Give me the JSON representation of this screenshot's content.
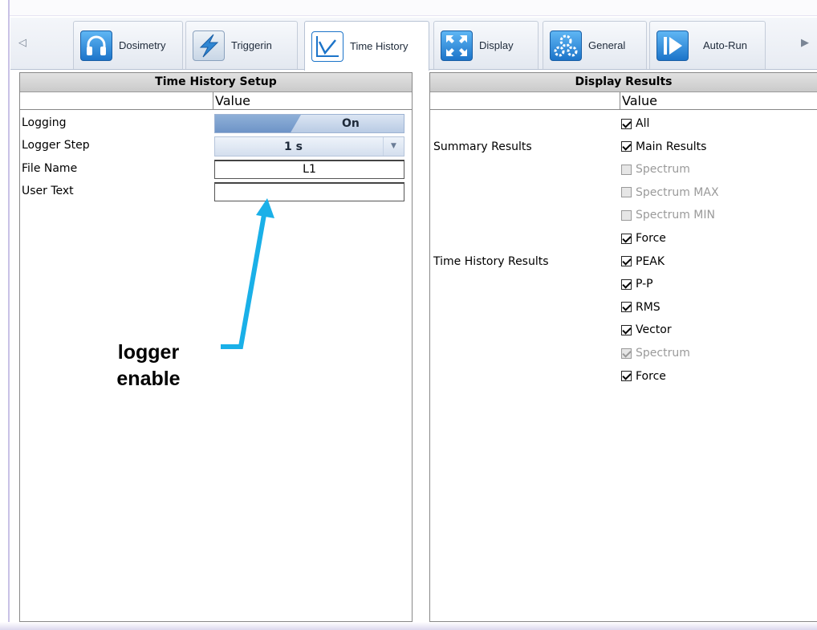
{
  "tabs": [
    {
      "label": "Dosimetry",
      "icon": "headphones-icon"
    },
    {
      "label": "Triggerin",
      "icon": "lightning-icon"
    },
    {
      "label": "Time History",
      "icon": "line-chart-icon",
      "active": true
    },
    {
      "label": "Display",
      "icon": "expand-arrows-icon"
    },
    {
      "label": "General",
      "icon": "gears-icon"
    },
    {
      "label": "Auto-Run",
      "icon": "play-icon"
    }
  ],
  "left_panel": {
    "title": "Time History Setup",
    "value_header": "Value",
    "rows": {
      "logging": {
        "label": "Logging",
        "value": "On",
        "level": 0.45
      },
      "logger_step": {
        "label": "Logger Step",
        "value": "1 s"
      },
      "file_name": {
        "label": "File Name",
        "value": "L1"
      },
      "user_text": {
        "label": "User Text",
        "value": ""
      }
    }
  },
  "right_panel": {
    "title": "Display Results",
    "value_header": "Value",
    "group_summary": "Summary Results",
    "group_time_history": "Time History Results",
    "items": [
      {
        "label": "All",
        "checked": true,
        "disabled": false
      },
      {
        "label": "Main Results",
        "checked": true,
        "disabled": false
      },
      {
        "label": "Spectrum",
        "checked": false,
        "disabled": true
      },
      {
        "label": "Spectrum MAX",
        "checked": false,
        "disabled": true
      },
      {
        "label": "Spectrum MIN",
        "checked": false,
        "disabled": true
      },
      {
        "label": "Force",
        "checked": true,
        "disabled": false
      },
      {
        "label": "PEAK",
        "checked": true,
        "disabled": false
      },
      {
        "label": "P-P",
        "checked": true,
        "disabled": false
      },
      {
        "label": "RMS",
        "checked": true,
        "disabled": false
      },
      {
        "label": "Vector",
        "checked": true,
        "disabled": false
      },
      {
        "label": "Spectrum",
        "checked": true,
        "disabled": true
      },
      {
        "label": "Force",
        "checked": true,
        "disabled": false
      }
    ]
  },
  "annotation": {
    "line1": "logger",
    "line2": "enable",
    "arrow_color": "#1ab0e8"
  },
  "colors": {
    "accent": "#1c74c9",
    "arrow": "#1ab0e8"
  }
}
